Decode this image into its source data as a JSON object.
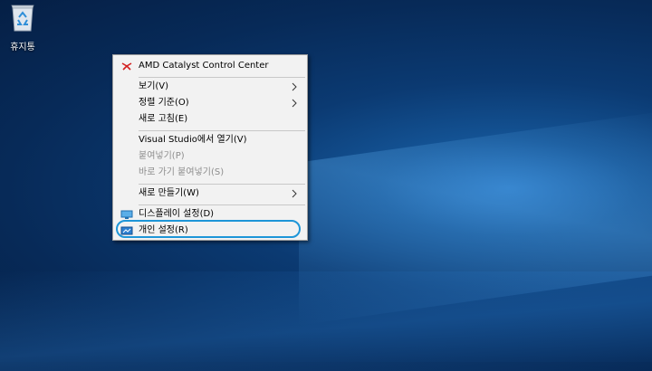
{
  "desktop": {
    "recycle_bin": {
      "label": "휴지통",
      "icon": "recycle-bin-icon"
    }
  },
  "context_menu": {
    "items": [
      {
        "label": "AMD Catalyst Control Center",
        "icon": "amd-logo-icon",
        "enabled": true
      },
      {
        "label": "보기(V)",
        "submenu": true,
        "enabled": true
      },
      {
        "label": "정렬 기준(O)",
        "submenu": true,
        "enabled": true
      },
      {
        "label": "새로 고침(E)",
        "enabled": true
      },
      {
        "label": "Visual Studio에서 열기(V)",
        "enabled": true
      },
      {
        "label": "붙여넣기(P)",
        "enabled": false
      },
      {
        "label": "바로 가기 붙여넣기(S)",
        "enabled": false
      },
      {
        "label": "새로 만들기(W)",
        "submenu": true,
        "enabled": true
      },
      {
        "label": "디스플레이 설정(D)",
        "icon": "display-icon",
        "enabled": true
      },
      {
        "label": "개인 설정(R)",
        "icon": "personalize-icon",
        "enabled": true,
        "highlighted": true
      }
    ]
  },
  "colors": {
    "highlight_ring": "#1e96d8",
    "menu_background": "#f2f2f2",
    "disabled_text": "#8d8d8d"
  }
}
